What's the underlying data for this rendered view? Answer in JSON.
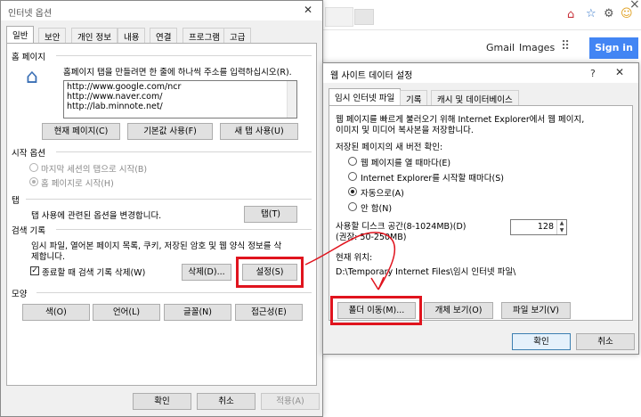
{
  "browser": {
    "gmail": "Gmail",
    "images": "Images",
    "signin": "Sign in",
    "tab_close": "×"
  },
  "internet_options": {
    "title": "인터넷 옵션",
    "help": "?",
    "close": "✕",
    "tabs": [
      "일반",
      "보안",
      "개인 정보",
      "내용",
      "연결",
      "프로그램",
      "고급"
    ],
    "home_section": "홈 페이지",
    "home_desc": "홈페이지 탭을 만들려면 한 줄에 하나씩 주소를 입력하십시오(R).",
    "home_urls": [
      "http://www.google.com/ncr",
      "http://www.naver.com/",
      "http://lab.minnote.net/"
    ],
    "btn_current": "현재 페이지(C)",
    "btn_default": "기본값 사용(F)",
    "btn_newtab": "새 탭 사용(U)",
    "startup_section": "시작 옵션",
    "startup_last": "마지막 세션의 탭으로 시작(B)",
    "startup_home": "홈 페이지로 시작(H)",
    "tabs_section": "탭",
    "tabs_desc": "탭 사용에 관련된 옵션을 변경합니다.",
    "btn_tabs": "탭(T)",
    "history_section": "검색 기록",
    "history_desc_1": "임시 파일, 열어본 페이지 목록, 쿠키, 저장된 암호 및 웹 양식 정보를 삭",
    "history_desc_2": "제합니다.",
    "history_check": "종료할 때 검색 기록 삭제(W)",
    "btn_delete": "삭제(D)...",
    "btn_settings": "설정(S)",
    "appearance_section": "모양",
    "btn_color": "색(O)",
    "btn_language": "언어(L)",
    "btn_font": "글꼴(N)",
    "btn_access": "접근성(E)",
    "ok": "확인",
    "cancel": "취소",
    "apply": "적용(A)"
  },
  "website_data": {
    "title": "웹 사이트 데이터 설정",
    "help": "?",
    "close": "✕",
    "tabs": [
      "임시 인터넷 파일",
      "기록",
      "캐시 및 데이터베이스"
    ],
    "desc_1": "웹 페이지를 빠르게 불러오기 위해 Internet Explorer에서 웹 페이지,",
    "desc_2": "이미지 및 미디어 복사본을 저장합니다.",
    "check_label": "저장된 페이지의 새 버전 확인:",
    "opt_every_visit": "웹 페이지를 열 때마다(E)",
    "opt_every_start": "Internet Explorer를 시작할 때마다(S)",
    "opt_auto": "자동으로(A)",
    "opt_never": "안 함(N)",
    "disk_label": "사용할 디스크 공간(8-1024MB)(D)",
    "disk_recommend": "(권장: 50-250MB)",
    "disk_value": "128",
    "location_label": "현재 위치:",
    "location_path": "D:\\Temporary Internet Files\\임시 인터넷 파일\\",
    "btn_move": "폴더 이동(M)...",
    "btn_objects": "개체 보기(O)",
    "btn_files": "파일 보기(V)",
    "ok": "확인",
    "cancel": "취소"
  },
  "colors": {
    "highlight": "#e0141e",
    "signin": "#4285f4"
  }
}
